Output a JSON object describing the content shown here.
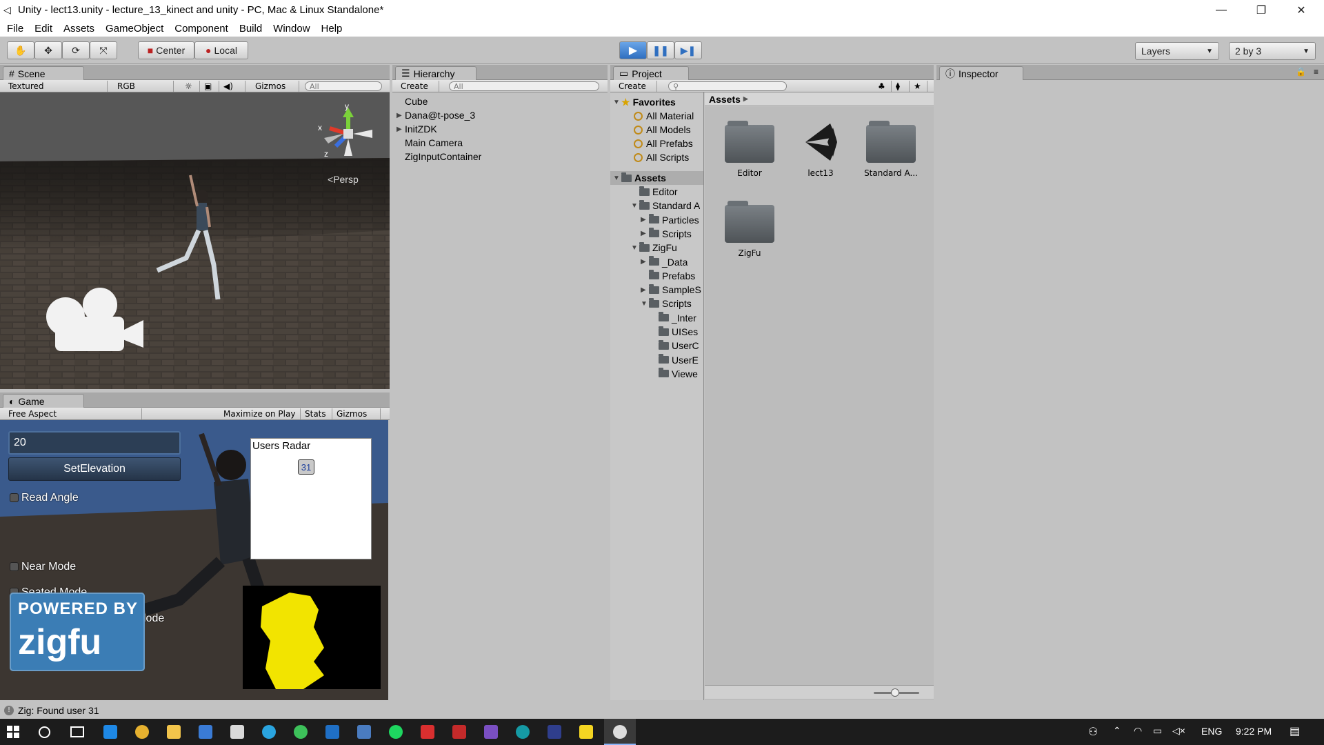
{
  "window": {
    "title": "Unity - lect13.unity - lecture_13_kinect and unity - PC, Mac & Linux Standalone*",
    "minimize": "—",
    "restore": "❐",
    "close": "✕"
  },
  "menu": [
    "File",
    "Edit",
    "Assets",
    "GameObject",
    "Component",
    "Build",
    "Window",
    "Help"
  ],
  "toolbar": {
    "pivot_label": "Center",
    "space_label": "Local",
    "layers_label": "Layers",
    "layout_label": "2 by 3"
  },
  "scene": {
    "tab": "Scene",
    "render_mode": "Textured",
    "color_mode": "RGB",
    "gizmos": "Gizmos",
    "search_placeholder": "All",
    "persp_label": "Persp",
    "axis_y": "y",
    "axis_x": "x",
    "axis_z": "z"
  },
  "game": {
    "tab": "Game",
    "aspect": "Free Aspect",
    "maximize": "Maximize on Play",
    "stats": "Stats",
    "gizmos": "Gizmos",
    "elevation_value": "20",
    "set_elevation": "SetElevation",
    "read_angle": "Read Angle",
    "near_mode": "Near Mode",
    "seated_mode": "Seated Mode",
    "hidden_mode_fragment": "lode",
    "radar_title": "Users Radar",
    "radar_user": "31",
    "powered_by": "POWERED BY",
    "brand": "zigfu"
  },
  "hierarchy": {
    "tab": "Hierarchy",
    "create": "Create",
    "search_placeholder": "All",
    "items": [
      {
        "label": "Cube",
        "expandable": false
      },
      {
        "label": "Dana@t-pose_3",
        "expandable": true
      },
      {
        "label": "InitZDK",
        "expandable": true
      },
      {
        "label": "Main Camera",
        "expandable": false
      },
      {
        "label": "ZigInputContainer",
        "expandable": false
      }
    ]
  },
  "project": {
    "tab": "Project",
    "create": "Create",
    "favorites_label": "Favorites",
    "favorites": [
      "All Material",
      "All Models",
      "All Prefabs",
      "All Scripts"
    ],
    "assets_label": "Assets",
    "tree": [
      {
        "label": "Editor",
        "indent": 1,
        "arrow": ""
      },
      {
        "label": "Standard A",
        "indent": 1,
        "arrow": "▼"
      },
      {
        "label": "Particles",
        "indent": 2,
        "arrow": "▶"
      },
      {
        "label": "Scripts",
        "indent": 2,
        "arrow": "▶"
      },
      {
        "label": "ZigFu",
        "indent": 1,
        "arrow": "▼"
      },
      {
        "label": "_Data",
        "indent": 2,
        "arrow": "▶"
      },
      {
        "label": "Prefabs",
        "indent": 2,
        "arrow": ""
      },
      {
        "label": "SampleS",
        "indent": 2,
        "arrow": "▶"
      },
      {
        "label": "Scripts",
        "indent": 2,
        "arrow": "▼"
      },
      {
        "label": "_Inter",
        "indent": 3,
        "arrow": ""
      },
      {
        "label": "UISes",
        "indent": 3,
        "arrow": ""
      },
      {
        "label": "UserC",
        "indent": 3,
        "arrow": ""
      },
      {
        "label": "UserE",
        "indent": 3,
        "arrow": ""
      },
      {
        "label": "Viewe",
        "indent": 3,
        "arrow": ""
      }
    ],
    "breadcrumb": "Assets",
    "grid": [
      {
        "label": "Editor",
        "kind": "folder"
      },
      {
        "label": "lect13",
        "kind": "unity"
      },
      {
        "label": "Standard A...",
        "kind": "folder"
      },
      {
        "label": "ZigFu",
        "kind": "folder"
      }
    ]
  },
  "inspector": {
    "tab": "Inspector"
  },
  "status": {
    "message": "Zig: Found user  31"
  },
  "taskbar": {
    "language": "ENG",
    "time": "9:22 PM"
  },
  "colors": {
    "play_active": "#3c7fd0",
    "scene_floor": "#3d3731",
    "game_sky": "#3a5a8c",
    "kinect_yellow": "#f2e400"
  }
}
